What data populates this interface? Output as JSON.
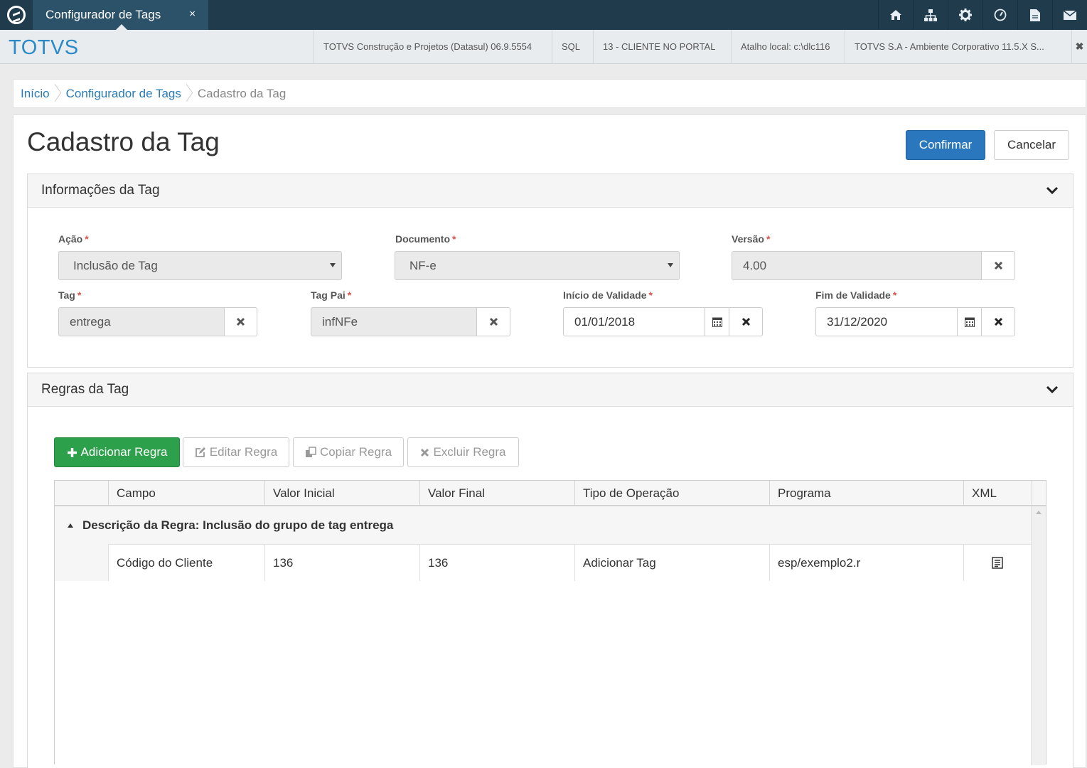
{
  "topbar": {
    "tab_title": "Configurador de Tags",
    "tab_close": "×",
    "icons": [
      "home-icon",
      "sitemap-icon",
      "gear-icon",
      "dashboard-icon",
      "document-icon",
      "mail-icon"
    ]
  },
  "header": {
    "brand": "TOTVS",
    "info": [
      "TOTVS Construção e Projetos (Datasul) 06.9.5554",
      "SQL",
      "13 - CLIENTE NO PORTAL",
      "Atalho local: c:\\dlc116",
      "TOTVS S.A - Ambiente Corporativo 11.5.X S..."
    ],
    "close": "✖"
  },
  "breadcrumb": {
    "home": "Início",
    "parent": "Configurador de Tags",
    "current": "Cadastro da Tag"
  },
  "page": {
    "title": "Cadastro da Tag",
    "confirm_label": "Confirmar",
    "cancel_label": "Cancelar"
  },
  "info_panel": {
    "title": "Informações da Tag",
    "required_mark": "*",
    "acao": {
      "label": "Ação",
      "value": "Inclusão de Tag"
    },
    "documento": {
      "label": "Documento",
      "value": "NF-e"
    },
    "versao": {
      "label": "Versão",
      "value": "4.00"
    },
    "tag": {
      "label": "Tag",
      "value": "entrega"
    },
    "tag_pai": {
      "label": "Tag Pai",
      "value": "infNFe"
    },
    "inicio": {
      "label": "Início de Validade",
      "value": "01/01/2018"
    },
    "fim": {
      "label": "Fim de Validade",
      "value": "31/12/2020"
    }
  },
  "rules_panel": {
    "title": "Regras da Tag",
    "buttons": {
      "add": "Adicionar Regra",
      "edit": "Editar Regra",
      "copy": "Copiar Regra",
      "delete": "Excluir Regra"
    },
    "columns": [
      "Campo",
      "Valor Inicial",
      "Valor Final",
      "Tipo de Operação",
      "Programa",
      "XML"
    ],
    "group_label": "Descrição da Regra: Inclusão do grupo de tag entrega",
    "rows": [
      {
        "campo": "Código do Cliente",
        "valor_inicial": "136",
        "valor_final": "136",
        "tipo": "Adicionar Tag",
        "programa": "esp/exemplo2.r",
        "xml_icon": "xml-document-icon"
      }
    ]
  },
  "colors": {
    "topbar": "#1f3b4c",
    "tab": "#2b5269",
    "brand": "#2a8ac8",
    "link": "#2a7bb5",
    "primary_button": "#2a77be",
    "success_button": "#2ca04a",
    "required": "#d9534f"
  }
}
